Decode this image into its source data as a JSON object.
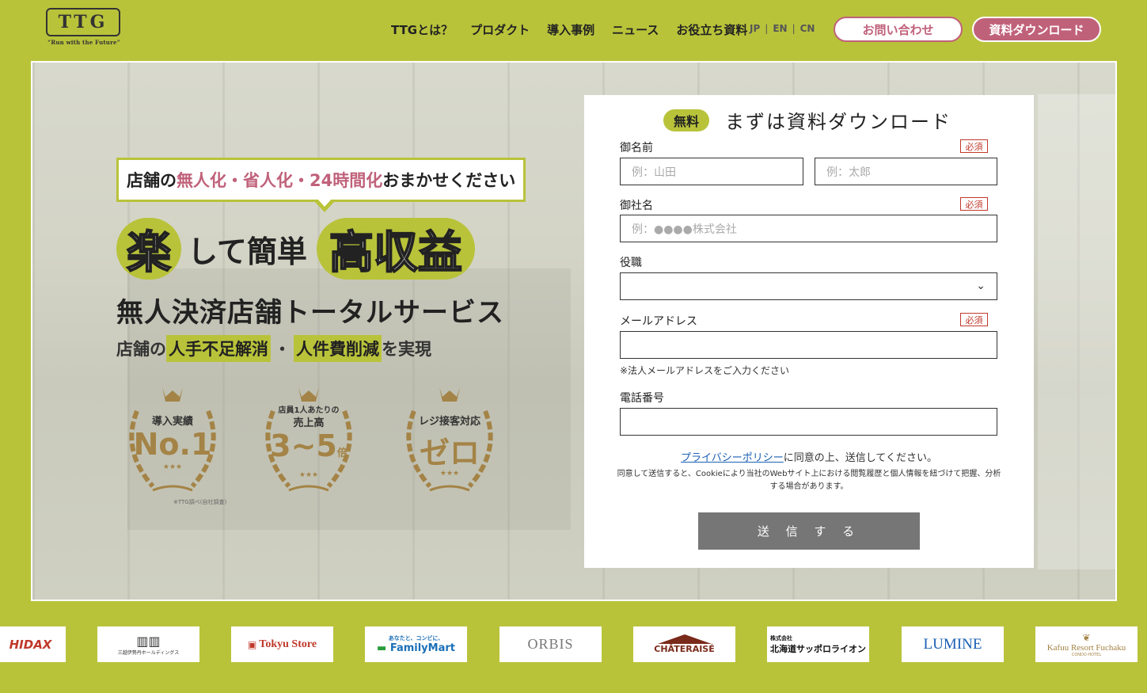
{
  "header": {
    "logo_text": "TTG",
    "logo_tagline": "“Run with the Future”",
    "nav": [
      "TTGとは？",
      "プロダクト",
      "導入事例",
      "ニュース",
      "お役立ち資料"
    ],
    "langs": [
      "JP",
      "EN",
      "CN"
    ],
    "lang_sep": "|",
    "contact_button": "お問い合わせ",
    "download_button": "資料ダウンロード"
  },
  "hero": {
    "catch_pre": "店舗の",
    "catch_pink": "無人化・省人化・24時間化",
    "catch_post": "おまかせください",
    "headline_circle1": "楽",
    "headline_mid": "して簡単",
    "headline_circle2": "高収益",
    "subtitle": "無人決済店舗トータルサービス",
    "tag_pre": "店舗の",
    "tag_hl1": "人手不足解消",
    "tag_dot": "・",
    "tag_hl2": "人件費削減",
    "tag_post": "を実現",
    "badges": [
      {
        "top_text": "導入実績",
        "main_text": "No.1",
        "suffix": ""
      },
      {
        "top_text": "店員1人あたりの",
        "top_text2": "売上高",
        "main_text": "3~5",
        "suffix": "倍"
      },
      {
        "top_text": "レジ接客対応",
        "main_text": "ゼロ",
        "suffix": ""
      }
    ],
    "note": "※TTG調べ(自社調査)",
    "stars": "★★★"
  },
  "form": {
    "free_badge": "無料",
    "title": "まずは資料ダウンロード",
    "required": "必須",
    "name_label": "御名前",
    "last_name_placeholder": "例：山田",
    "first_name_placeholder": "例：太郎",
    "company_label": "御社名",
    "company_placeholder": "例：●●●●株式会社",
    "position_label": "役職",
    "position_value": "",
    "email_label": "メールアドレス",
    "email_hint": "※法人メールアドレスをご入力ください",
    "phone_label": "電話番号",
    "privacy_link": "プライバシーポリシー",
    "privacy_text": "に同意の上、送信してください。",
    "cookie_text": "同意して送信すると、Cookieにより当社のWebサイト上における閲覧履歴と個人情報を紐づけて把握、分析する場合があります。",
    "submit": "送 信 す る"
  },
  "clients": [
    {
      "name": "HIDAX",
      "color": "#c0392b"
    },
    {
      "name": "三越伊勢丹ホールディングス",
      "color": "#333333"
    },
    {
      "name": "Tokyu Store",
      "color": "#c0392b"
    },
    {
      "name": "FamilyMart",
      "tagline": "あなたと、コンビに、",
      "color": "#1a6fb8"
    },
    {
      "name": "ORBIS",
      "color": "#777777"
    },
    {
      "name": "CHÂTERAISÉ",
      "color": "#7a2a1a"
    },
    {
      "name": "北海道サッポロライオン",
      "prefix": "株式会社",
      "color": "#111111"
    },
    {
      "name": "LUMINE",
      "color": "#1a5fb4"
    },
    {
      "name": "Kafuu Resort Fuchaku",
      "tagline": "CONDO·HOTEL",
      "color": "#a48346"
    }
  ],
  "colors": {
    "accent_green": "#b9c33a",
    "accent_pink": "#c0617a",
    "gold": "#a48346"
  }
}
